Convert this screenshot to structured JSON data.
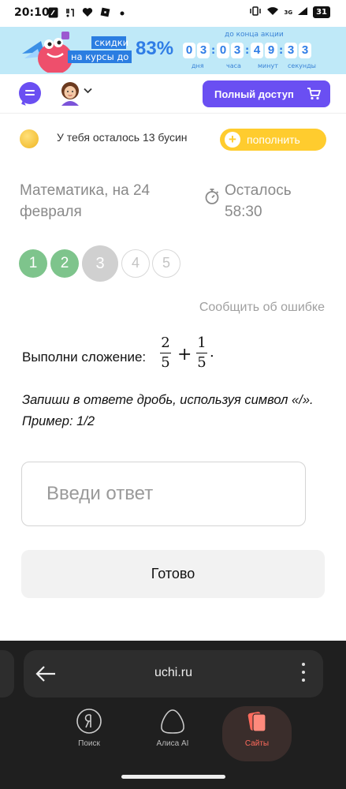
{
  "status_bar": {
    "time": "20:10",
    "network": "3G",
    "battery": "31",
    "left_icons": [
      "app-notification-icon",
      "missed-call-icon",
      "heart-icon",
      "roblox-icon",
      "dot-icon"
    ],
    "right_icons": [
      "vibrate-icon",
      "wifi-icon",
      "signal-icon",
      "battery-icon"
    ]
  },
  "promo": {
    "tag_line1": "скидки",
    "tag_line2": "на курсы до",
    "percent": "83%",
    "until_label": "до конца акции",
    "digits": [
      "0",
      "3",
      "0",
      "3",
      "4",
      "9",
      "3",
      "3"
    ],
    "labels": {
      "days": "дня",
      "hours": "часа",
      "minutes": "минут",
      "seconds": "секунды"
    },
    "colors": {
      "background": "#bfe9f8",
      "accent": "#2f7de6"
    }
  },
  "header": {
    "full_access_label": "Полный доступ",
    "accent_color": "#6a4ff2"
  },
  "beads": {
    "text": "У тебя осталось 13 бусин",
    "refill_label": "пополнить",
    "refill_color": "#ffcc2e"
  },
  "lesson": {
    "title": "Математика, на 24 февраля",
    "remaining": "Осталось 58:30"
  },
  "steps": [
    {
      "label": "1",
      "state": "done"
    },
    {
      "label": "2",
      "state": "done"
    },
    {
      "label": "3",
      "state": "current"
    },
    {
      "label": "4",
      "state": "todo"
    },
    {
      "label": "5",
      "state": "todo"
    }
  ],
  "report_link": "Сообщить об ошибке",
  "task": {
    "prompt": "Выполни сложение:",
    "frac1_num": "2",
    "frac1_den": "5",
    "operator": "+",
    "frac2_num": "1",
    "frac2_den": "5",
    "end": ".",
    "instruction": "Запиши в ответе дробь, используя символ «/». Пример: 1/2"
  },
  "answer": {
    "placeholder": "Введи ответ",
    "value": ""
  },
  "done_button": "Готово",
  "browser": {
    "url": "uchi.ru",
    "nav": [
      {
        "label": "Поиск",
        "icon": "yandex-search-icon"
      },
      {
        "label": "Алиса AI",
        "icon": "alice-icon"
      },
      {
        "label": "Сайты",
        "icon": "sites-icon",
        "active": true
      }
    ],
    "active_color": "#ff6a5c"
  }
}
